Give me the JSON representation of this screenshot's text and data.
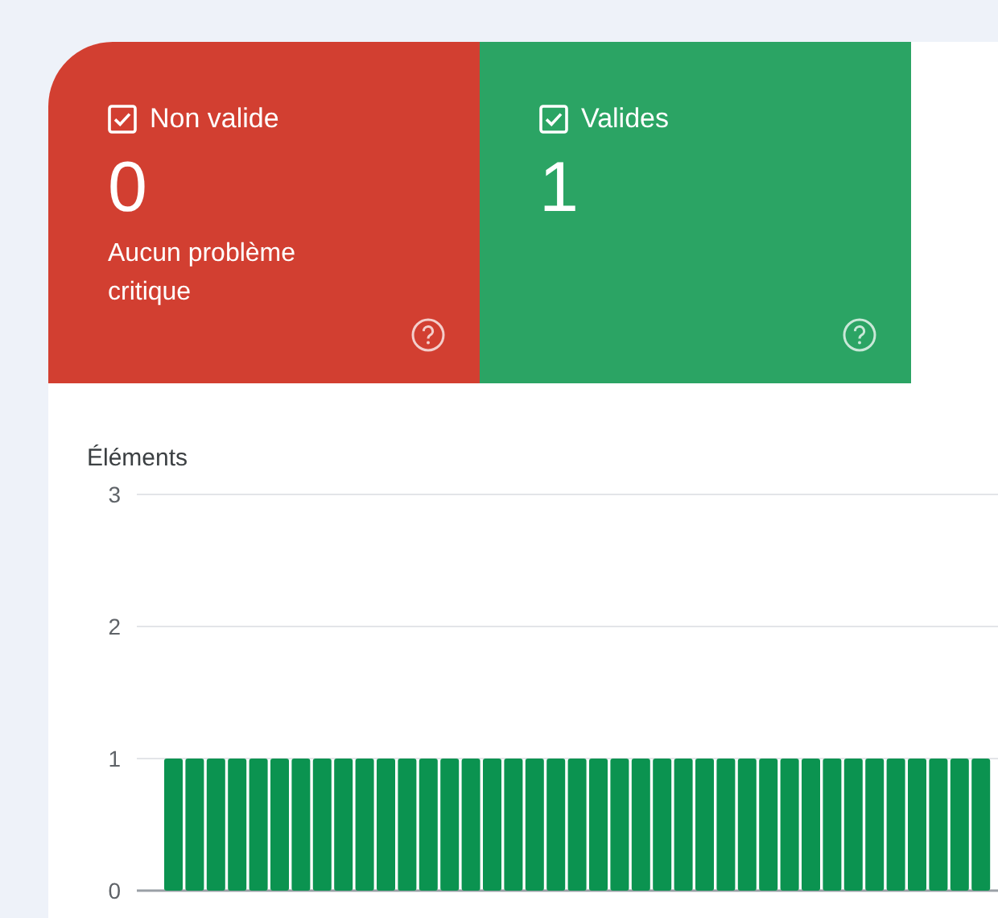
{
  "tiles": [
    {
      "label": "Non valide",
      "checked": true,
      "count": "0",
      "description": "Aucun problème critique",
      "color": "#d23f31"
    },
    {
      "label": "Valides",
      "checked": true,
      "count": "1",
      "color": "#2ba464"
    }
  ],
  "chart": {
    "chart_data": {
      "type": "bar",
      "ylabel": "Éléments",
      "ylim": [
        0,
        3
      ],
      "yticks": [
        0,
        1,
        2,
        3
      ],
      "series": [
        {
          "color": "#0b9350",
          "values": [
            1,
            1,
            1,
            1,
            1,
            1,
            1,
            1,
            1,
            1,
            1,
            1,
            1,
            1,
            1,
            1,
            1,
            1,
            1,
            1,
            1,
            1,
            1,
            1,
            1,
            1,
            1,
            1,
            1,
            1,
            1,
            1,
            1,
            1,
            1,
            1,
            1,
            1,
            1
          ]
        }
      ]
    }
  }
}
